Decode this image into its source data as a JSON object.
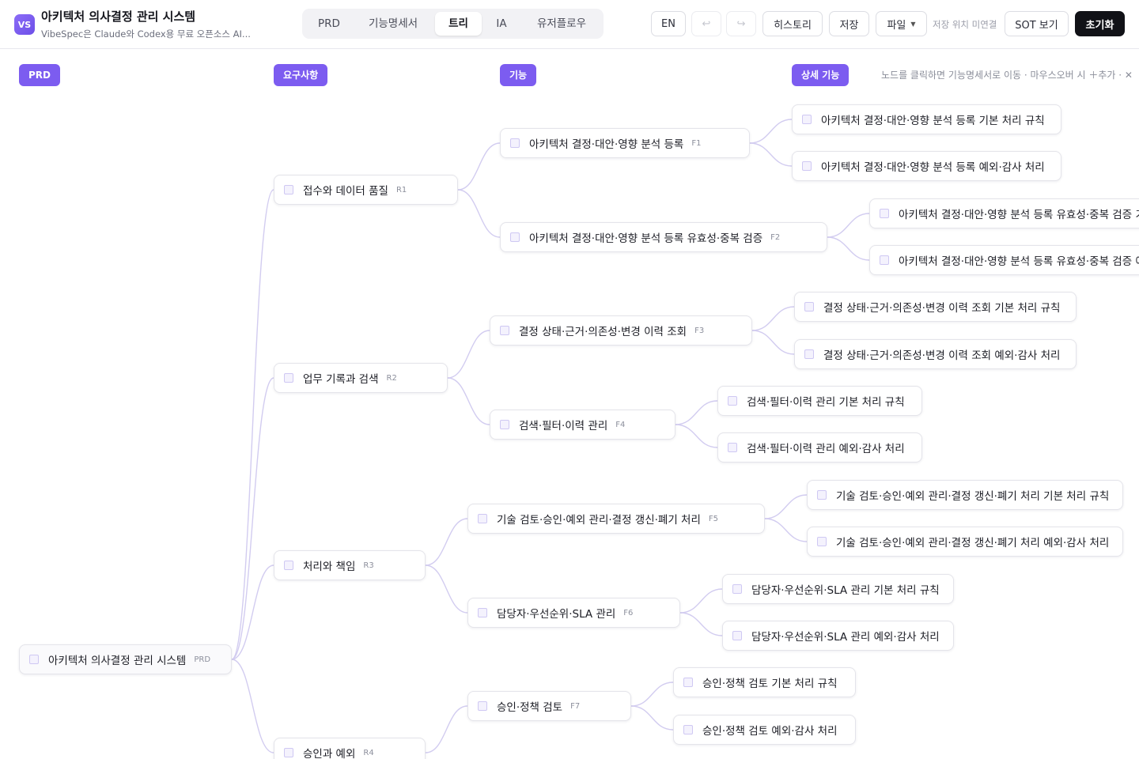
{
  "app": {
    "logo": "VS",
    "title": "아키텍처 의사결정 관리 시스템",
    "subtitle": "VibeSpec은 Claude와 Codex용 무료 오픈소스 AI..."
  },
  "tabs": [
    "PRD",
    "기능명세서",
    "트리",
    "IA",
    "유저플로우"
  ],
  "active_tab": "트리",
  "toolbar": {
    "lang": "EN",
    "undo_icon": "↩",
    "redo_icon": "↪",
    "history": "히스토리",
    "save": "저장",
    "file": "파일",
    "save_status": "저장 위치 미연결",
    "sot": "SOT 보기",
    "reset": "초기화"
  },
  "columns": [
    "PRD",
    "요구사항",
    "기능",
    "상세 기능"
  ],
  "hint": "노드를 클릭하면 기능명세서로 이동 · 마우스오버 시 ＋추가 · ✕",
  "colors": {
    "accent": "#7c5cf0",
    "link": "#d2ccf0"
  },
  "tree": {
    "root": {
      "label": "아키텍처 의사결정 관리 시스템",
      "code": "PRD"
    },
    "requirements": [
      {
        "label": "접수와 데이터 품질",
        "code": "R1"
      },
      {
        "label": "업무 기록과 검색",
        "code": "R2"
      },
      {
        "label": "처리와 책임",
        "code": "R3"
      },
      {
        "label": "승인과 예외",
        "code": "R4"
      }
    ],
    "features": [
      {
        "label": "아키텍처 결정·대안·영향 분석 등록",
        "code": "F1"
      },
      {
        "label": "아키텍처 결정·대안·영향 분석 등록 유효성·중복 검증",
        "code": "F2"
      },
      {
        "label": "결정 상태·근거·의존성·변경 이력 조회",
        "code": "F3"
      },
      {
        "label": "검색·필터·이력 관리",
        "code": "F4"
      },
      {
        "label": "기술 검토·승인·예외 관리·결정 갱신·폐기 처리",
        "code": "F5"
      },
      {
        "label": "담당자·우선순위·SLA 관리",
        "code": "F6"
      },
      {
        "label": "승인·정책 검토",
        "code": "F7"
      }
    ],
    "details": [
      {
        "label": "아키텍처 결정·대안·영향 분석 등록 기본 처리 규칙"
      },
      {
        "label": "아키텍처 결정·대안·영향 분석 등록 예외·감사 처리"
      },
      {
        "label": "아키텍처 결정·대안·영향 분석 등록 유효성·중복 검증 기본 처리 규칙"
      },
      {
        "label": "아키텍처 결정·대안·영향 분석 등록 유효성·중복 검증 예외·감사 처리"
      },
      {
        "label": "결정 상태·근거·의존성·변경 이력 조회 기본 처리 규칙"
      },
      {
        "label": "결정 상태·근거·의존성·변경 이력 조회 예외·감사 처리"
      },
      {
        "label": "검색·필터·이력 관리 기본 처리 규칙"
      },
      {
        "label": "검색·필터·이력 관리 예외·감사 처리"
      },
      {
        "label": "기술 검토·승인·예외 관리·결정 갱신·폐기 처리 기본 처리 규칙"
      },
      {
        "label": "기술 검토·승인·예외 관리·결정 갱신·폐기 처리 예외·감사 처리"
      },
      {
        "label": "담당자·우선순위·SLA 관리 기본 처리 규칙"
      },
      {
        "label": "담당자·우선순위·SLA 관리 예외·감사 처리"
      },
      {
        "label": "승인·정책 검토 기본 처리 규칙"
      },
      {
        "label": "승인·정책 검토 예외·감사 처리"
      }
    ]
  }
}
